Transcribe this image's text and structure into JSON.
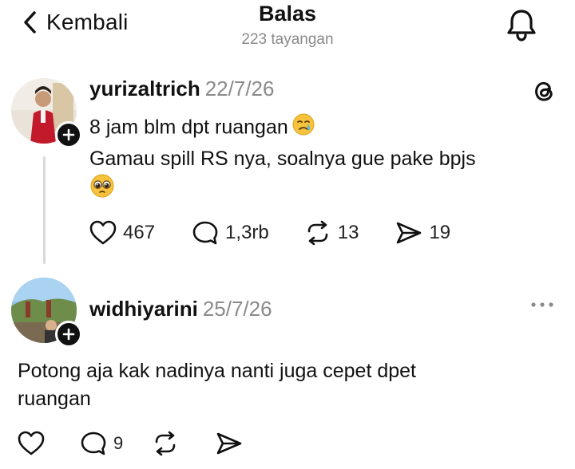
{
  "header": {
    "back_label": "Kembali",
    "title": "Balas",
    "views": "223 tayangan"
  },
  "post": {
    "username": "yurizaltrich",
    "date": "22/7/26",
    "line1": "8 jam blm dpt ruangan",
    "line2": "Gamau spill RS nya, soalnya gue pake bpjs",
    "likes": "467",
    "replies": "1,3rb",
    "reposts": "13",
    "shares": "19"
  },
  "reply": {
    "username": "widhiyarini",
    "date": "25/7/26",
    "line1": "Potong aja kak nadinya nanti juga cepet dpet",
    "line2": "ruangan",
    "replies": "9"
  }
}
